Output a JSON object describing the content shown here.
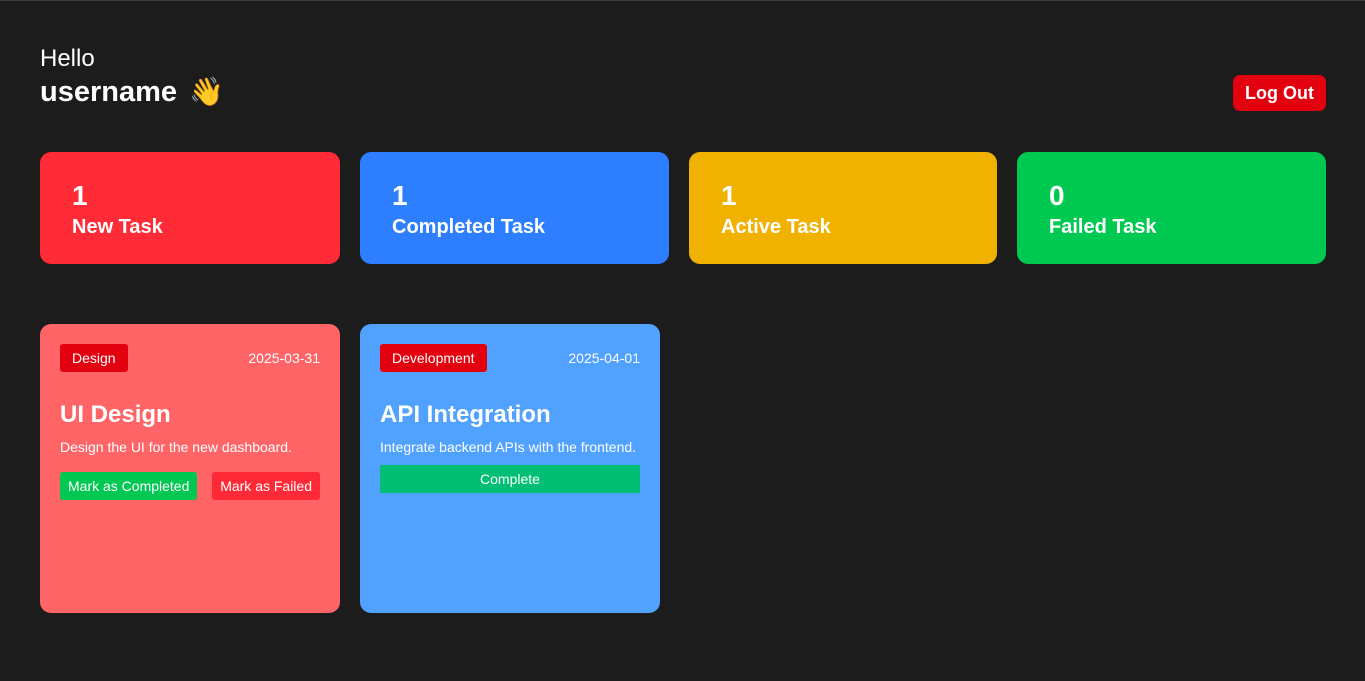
{
  "header": {
    "greeting": "Hello",
    "username": "username",
    "wave_emoji": "👋",
    "logout_label": "Log Out"
  },
  "stats": [
    {
      "count": "1",
      "label": "New Task",
      "color": "#ff2b36"
    },
    {
      "count": "1",
      "label": "Completed Task",
      "color": "#2d7fff"
    },
    {
      "count": "1",
      "label": "Active Task",
      "color": "#f0b100"
    },
    {
      "count": "0",
      "label": "Failed Task",
      "color": "#00c951"
    }
  ],
  "tasks": [
    {
      "category": "Design",
      "date": "2025-03-31",
      "title": "UI Design",
      "description": "Design the UI for the new dashboard.",
      "color": "#ff6467",
      "actions": {
        "complete_label": "Mark as Completed",
        "failed_label": "Mark as Failed"
      }
    },
    {
      "category": "Development",
      "date": "2025-04-01",
      "title": "API Integration",
      "description": "Integrate backend APIs with the frontend.",
      "color": "#51a2ff",
      "status_label": "Complete"
    }
  ],
  "colors": {
    "background": "#1c1c1c",
    "logout": "#e3000f",
    "category_badge": "#e3000f",
    "complete_green": "#00c853",
    "failed_red": "#ff2a38",
    "complete_full": "#00bf75"
  }
}
